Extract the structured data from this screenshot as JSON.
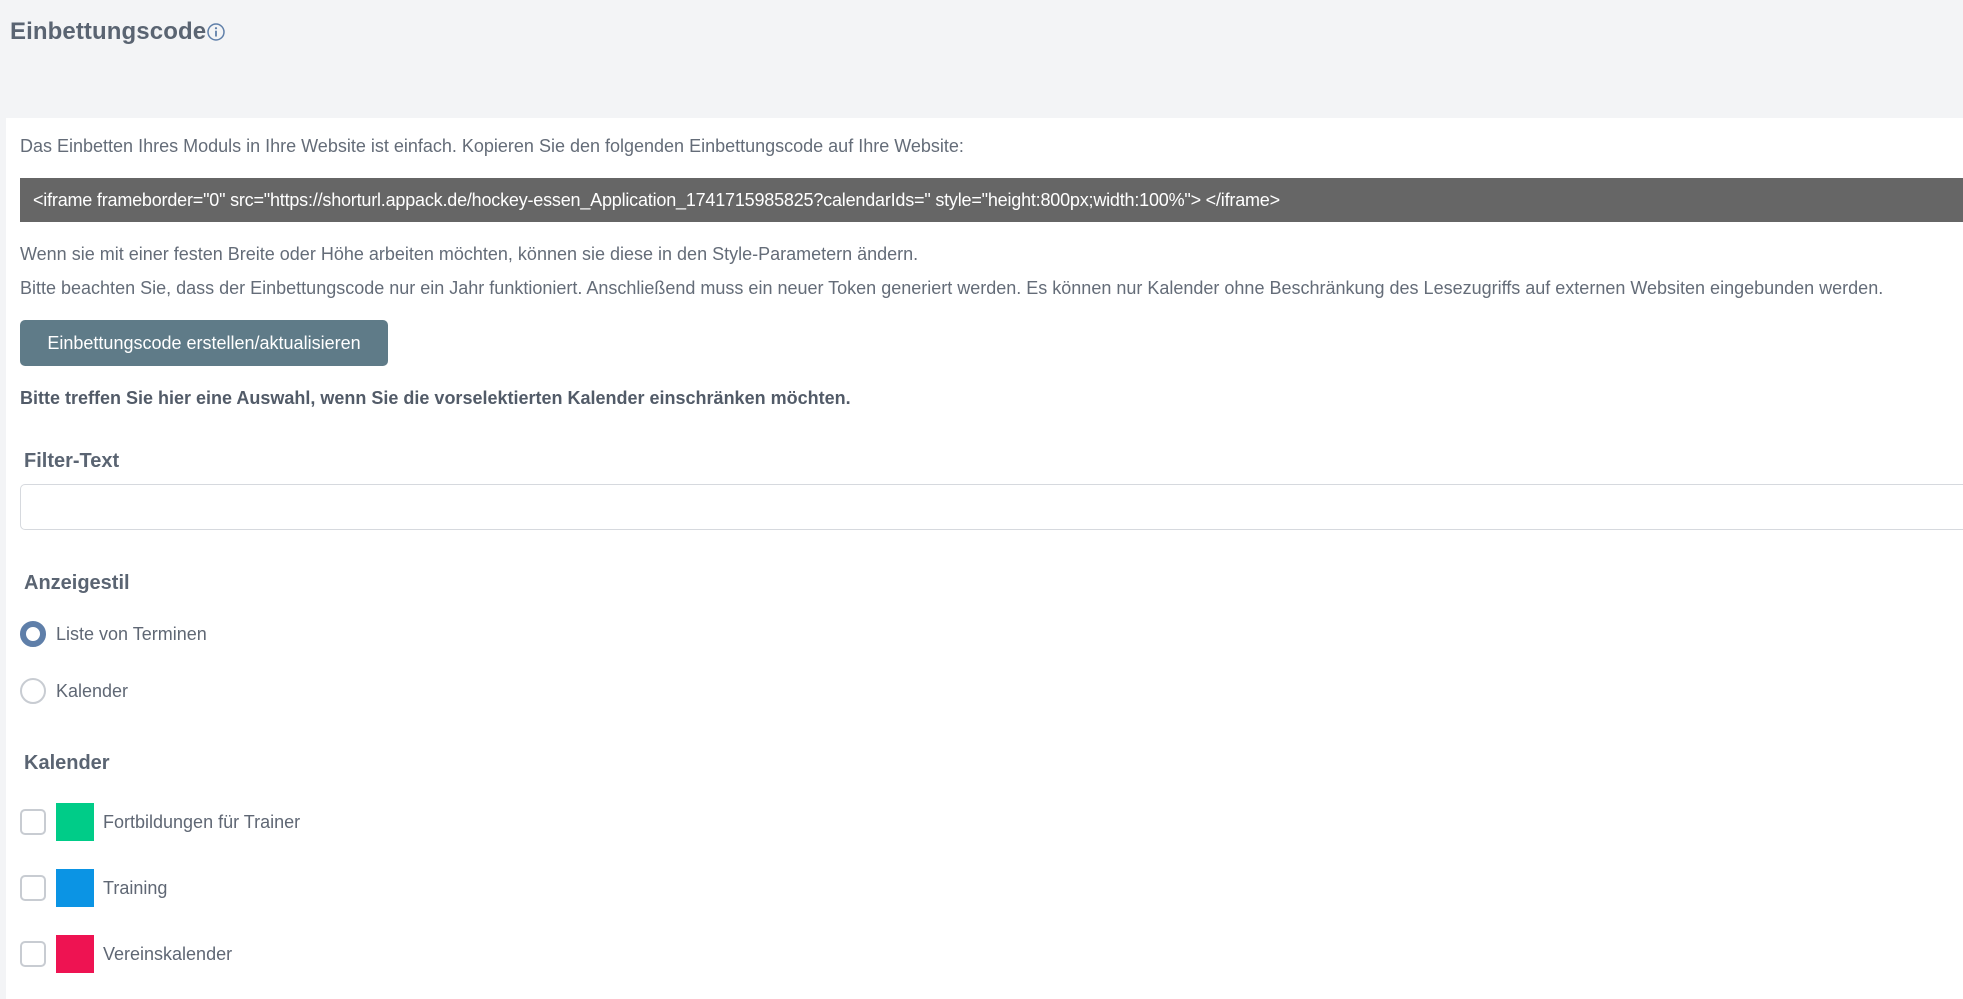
{
  "header": {
    "title": "Einbettungscode",
    "info_icon": "info-circle-icon"
  },
  "main": {
    "intro": "Das Einbetten Ihres Moduls in Ihre Website ist einfach. Kopieren Sie den folgenden Einbettungscode auf Ihre Website:",
    "embed_code": "<iframe frameborder=\"0\" src=\"https://shorturl.appack.de/hockey-essen_Application_1741715985825?calendarIds=\" style=\"height:800px;width:100%\"> </iframe>",
    "note_style": "Wenn sie mit einer festen Breite oder Höhe arbeiten möchten, können sie diese in den Style-Parametern ändern.",
    "note_token": "Bitte beachten Sie, dass der Einbettungscode nur ein Jahr funktioniert. Anschließend muss ein neuer Token generiert werden. Es können nur Kalender ohne Beschränkung des Lesezugriffs auf externen Websiten eingebunden werden.",
    "create_button_label": "Einbettungscode erstellen/aktualisieren",
    "selection_hint": "Bitte treffen Sie hier eine Auswahl, wenn Sie die vorselektierten Kalender einschränken möchten.",
    "filter": {
      "label": "Filter-Text",
      "value": "",
      "placeholder": ""
    },
    "display_style": {
      "label": "Anzeigestil",
      "options": [
        {
          "label": "Liste von Terminen",
          "selected": true
        },
        {
          "label": "Kalender",
          "selected": false
        }
      ]
    },
    "calendars": {
      "label": "Kalender",
      "items": [
        {
          "label": "Fortbildungen für Trainer",
          "color": "#00cc88",
          "checked": false
        },
        {
          "label": "Training",
          "color": "#0b94e4",
          "checked": false
        },
        {
          "label": "Vereinskalender",
          "color": "#ee1352",
          "checked": false
        }
      ]
    }
  },
  "colors": {
    "accent_button": "#5f7b88",
    "radio_selected": "#5f7fa9",
    "code_background": "#666666",
    "page_background": "#f3f4f6"
  }
}
